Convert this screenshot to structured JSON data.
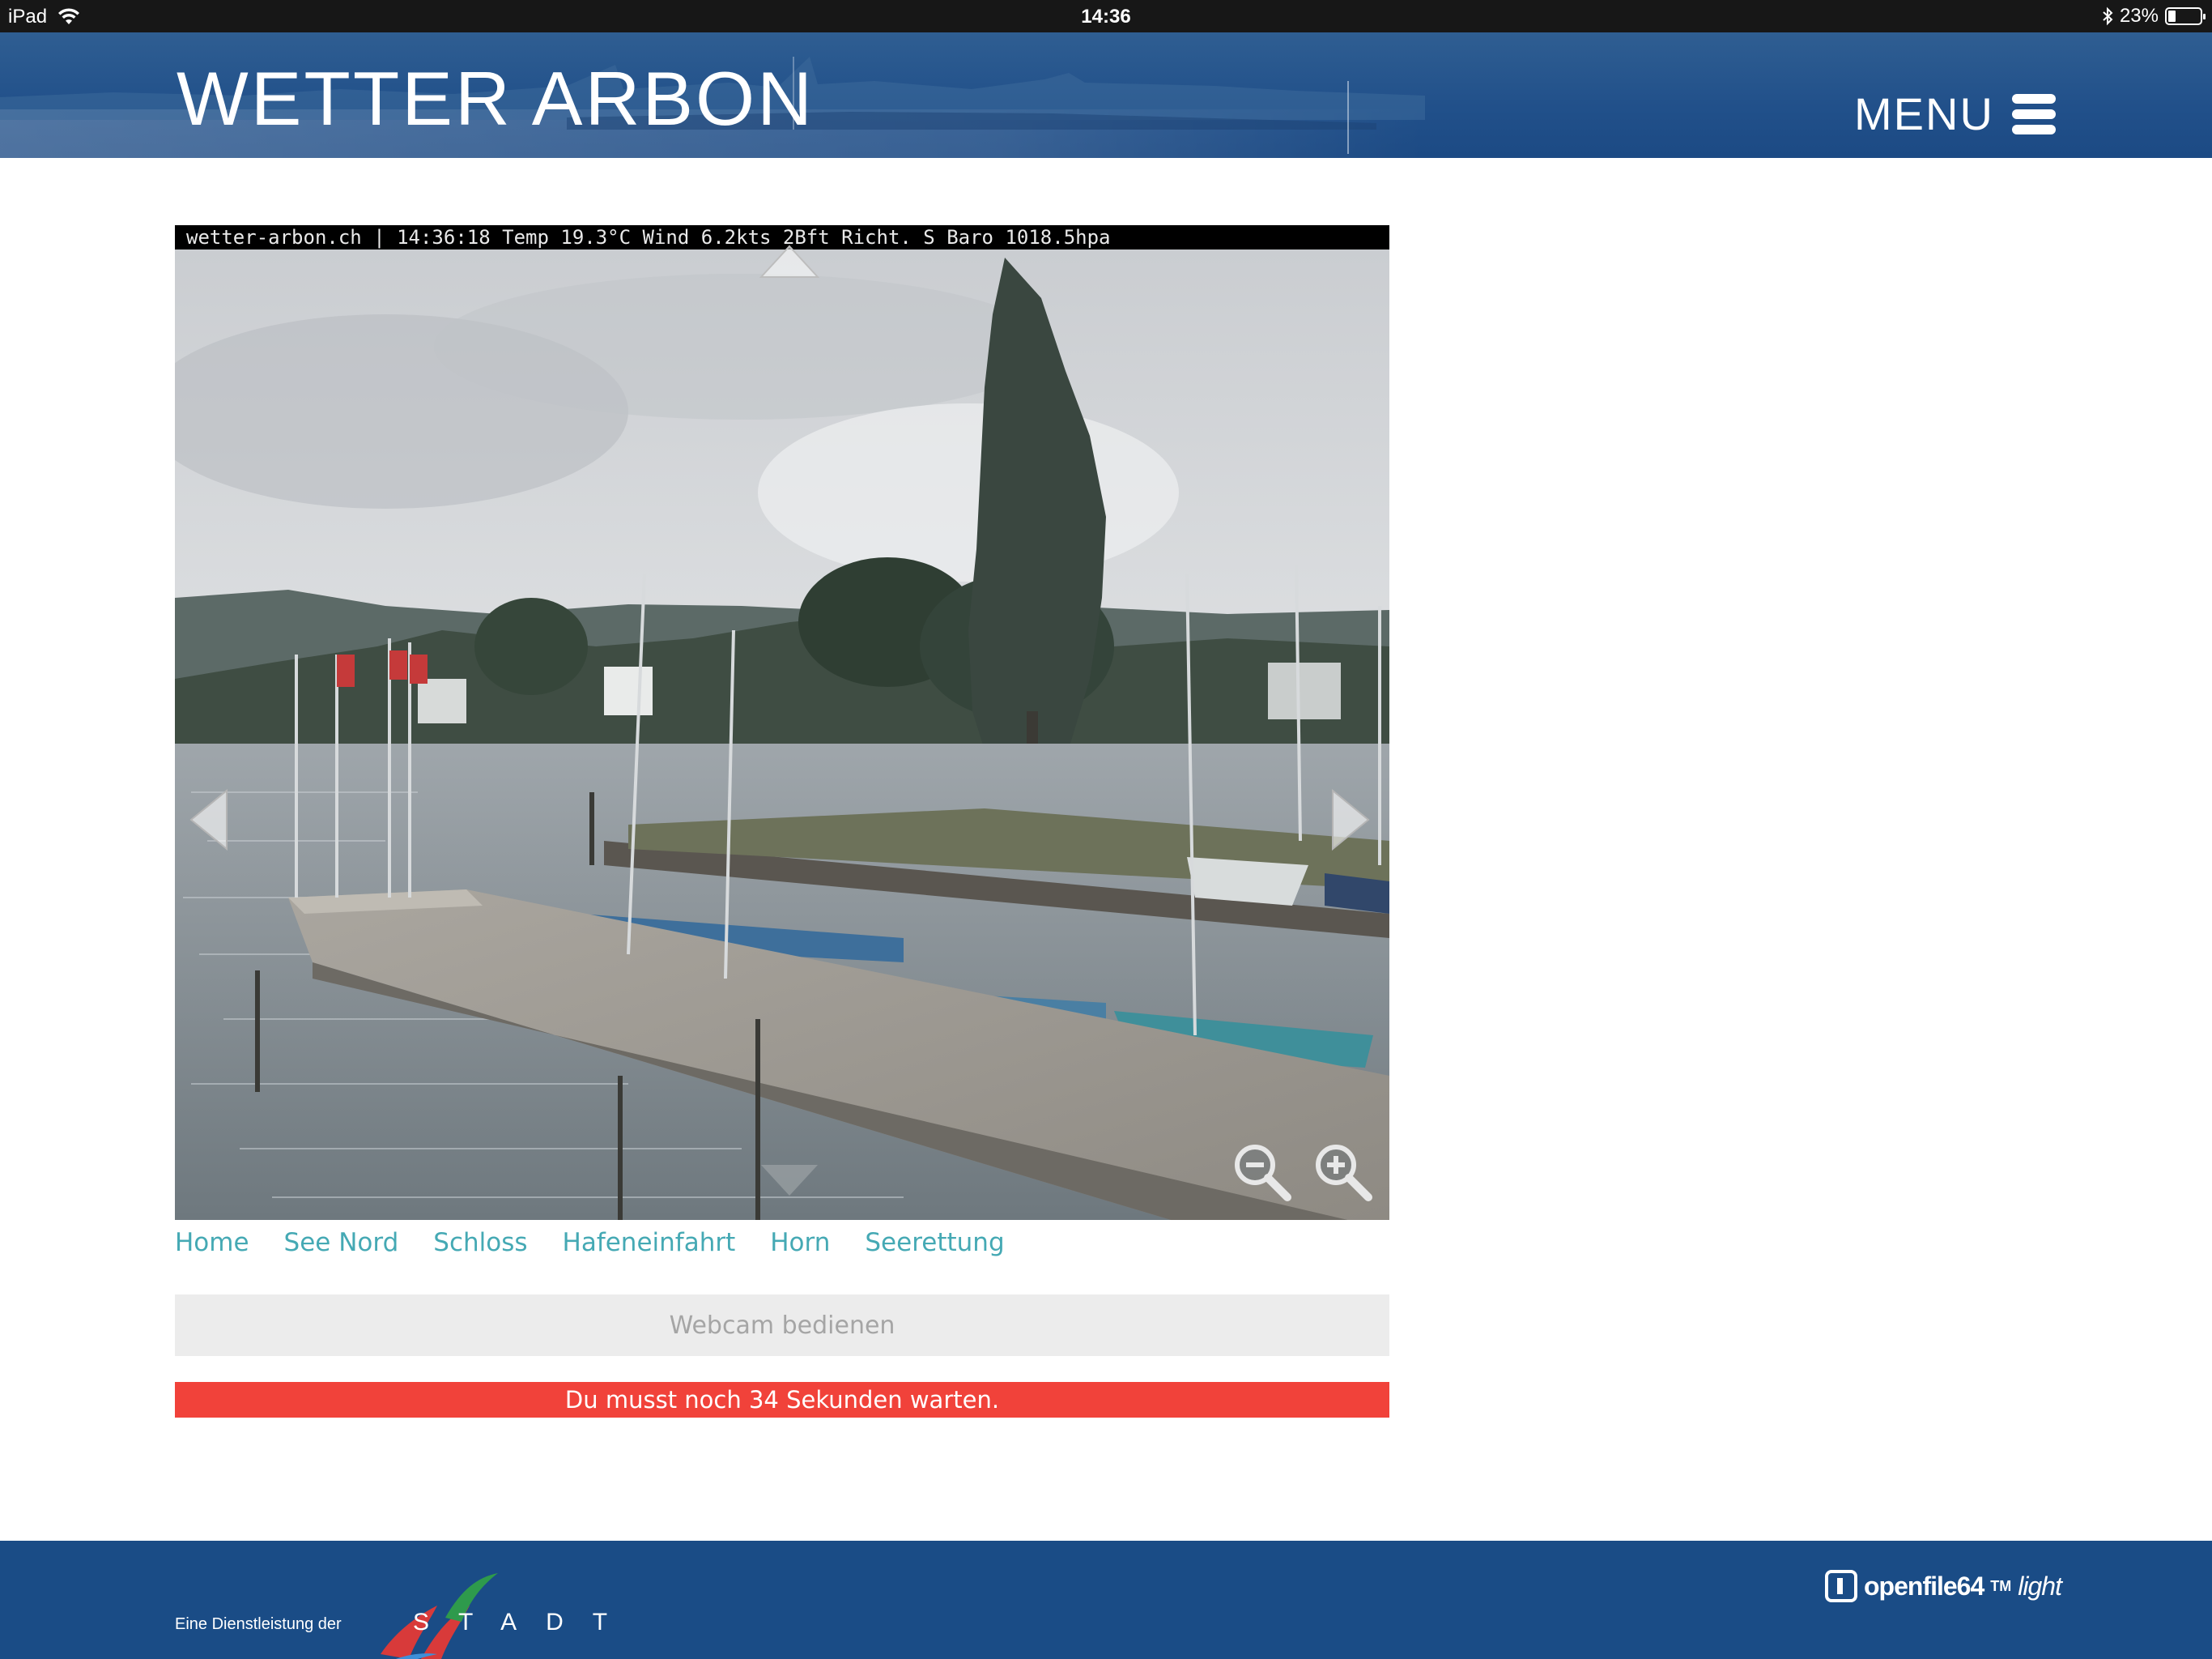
{
  "status_bar": {
    "device": "iPad",
    "time": "14:36",
    "battery": "23%",
    "battery_level": 0.23,
    "icons": [
      "wifi-icon",
      "bluetooth-icon",
      "battery-icon"
    ]
  },
  "header": {
    "title": "WETTER ARBON",
    "menu_label": "MENU"
  },
  "webcam": {
    "overlay_text": "wetter-arbon.ch | 14:36:18 Temp 19.3°C Wind 6.2kts 2Bft Richt. S Baro 1018.5hpa",
    "controls": [
      "pan-up-arrow",
      "pan-down-arrow",
      "pan-left-arrow",
      "pan-right-arrow",
      "zoom-out-icon",
      "zoom-in-icon"
    ]
  },
  "cam_links": [
    {
      "label": "Home"
    },
    {
      "label": "See Nord"
    },
    {
      "label": "Schloss"
    },
    {
      "label": "Hafeneinfahrt"
    },
    {
      "label": "Horn"
    },
    {
      "label": "Seerettung"
    }
  ],
  "control_button": {
    "label": "Webcam bedienen"
  },
  "wait_notice": {
    "text": "Du musst noch 34 Sekunden warten."
  },
  "footer": {
    "credit": "Eine Dienstleistung der",
    "stadt_logo": "STADT",
    "openfile_name": "openfile64",
    "openfile_tm": "TM",
    "openfile_light": "light"
  },
  "colors": {
    "header_blue": "#21508a",
    "footer_blue": "#1a4c86",
    "link_teal": "#45a9b4",
    "alert_red": "#f1423a"
  }
}
